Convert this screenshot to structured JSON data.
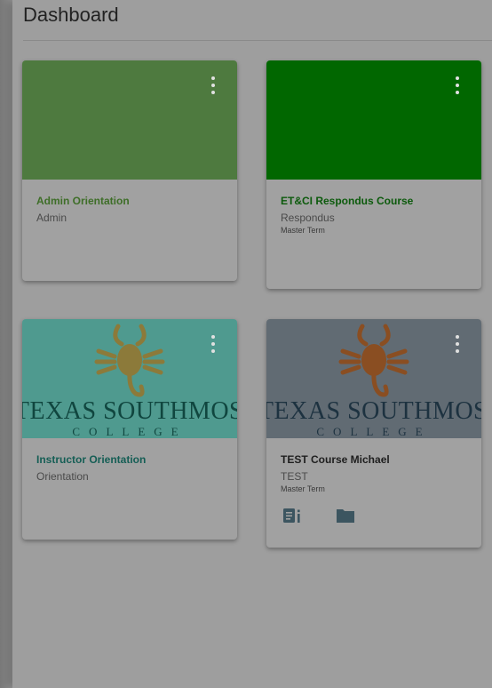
{
  "header": {
    "title": "Dashboard"
  },
  "colors": {
    "green_card": "#4e7a3f",
    "dark_green_card": "#016700",
    "teal_card": "#4f9a8f",
    "slate_card": "#616b73",
    "name_green": "#3e6e28",
    "name_dark_green": "#0c5a0c",
    "name_teal": "#155e55",
    "name_dark": "#1e1e1e",
    "logo_teal_text": "#10463f",
    "logo_slate_text": "#1d3240",
    "scorpion_teal": "#8c7a3a",
    "scorpion_slate": "#8a4e22"
  },
  "logo": {
    "line1": "TEXAS SOUTHMOS",
    "line2": "COLLEGE",
    "icon": "scorpion-icon"
  },
  "cards": [
    {
      "name": "Admin Orientation",
      "code": "Admin",
      "term": "",
      "hero": "solid-green",
      "menu_icon": "more-vertical-icon"
    },
    {
      "name": "ET&CI Respondus Course",
      "code": "Respondus",
      "term": "Master Term",
      "hero": "solid-dark-green",
      "menu_icon": "more-vertical-icon"
    },
    {
      "name": "Instructor Orientation",
      "code": "Orientation",
      "term": "",
      "hero": "logo-teal",
      "menu_icon": "more-vertical-icon"
    },
    {
      "name": "TEST Course Michael",
      "code": "TEST",
      "term": "Master Term",
      "hero": "logo-slate",
      "menu_icon": "more-vertical-icon",
      "actions": [
        {
          "icon": "announcements-icon"
        },
        {
          "icon": "files-folder-icon"
        }
      ]
    }
  ]
}
